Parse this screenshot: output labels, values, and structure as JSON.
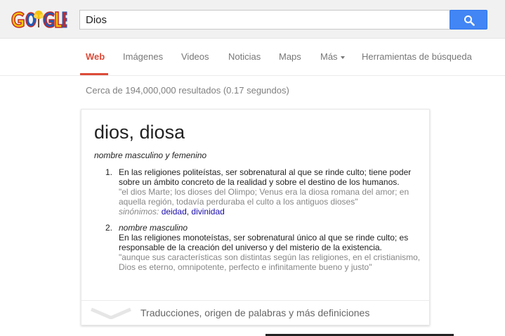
{
  "header": {
    "logo_text": "GOOGLE",
    "search_value": "Dios"
  },
  "nav": {
    "tabs": [
      {
        "label": "Web",
        "active": true
      },
      {
        "label": "Imágenes"
      },
      {
        "label": "Videos"
      },
      {
        "label": "Noticias"
      },
      {
        "label": "Maps"
      },
      {
        "label": "Más"
      },
      {
        "label": "Herramientas de búsqueda"
      }
    ]
  },
  "results": {
    "stats": "Cerca de 194,000,000 resultados (0.17 segundos)"
  },
  "definition": {
    "headword": "dios, diosa",
    "part_of_speech": "nombre masculino y femenino",
    "senses": [
      {
        "number": "1.",
        "definition": "En las religiones politeístas, ser sobrenatural al que se rinde culto; tiene poder sobre un ámbito concreto de la realidad y sobre el destino de los humanos.",
        "example": "\"el dios Marte; los dioses del Olimpo; Venus era la diosa romana del amor; en aquella región, todavía perduraba el culto a los antiguos dioses\"",
        "synonyms_label": "sinónimos:",
        "synonyms": [
          "deidad",
          "divinidad"
        ]
      },
      {
        "number": "2.",
        "grammar": "nombre masculino",
        "definition": "En las religiones monoteístas, ser sobrenatural único al que se rinde culto; es responsable de la creación del universo y del misterio de la existencia.",
        "example": "\"aunque sus características son distintas según las religiones, en el cristianismo, Dios es eterno, omnipotente, perfecto e infinitamente bueno y justo\""
      }
    ],
    "footer_text": "Traducciones, origen de palabras y más definiciones"
  },
  "colors": {
    "accent": "#dd4b39",
    "search_button": "#4285f4",
    "link": "#1a0dab"
  }
}
